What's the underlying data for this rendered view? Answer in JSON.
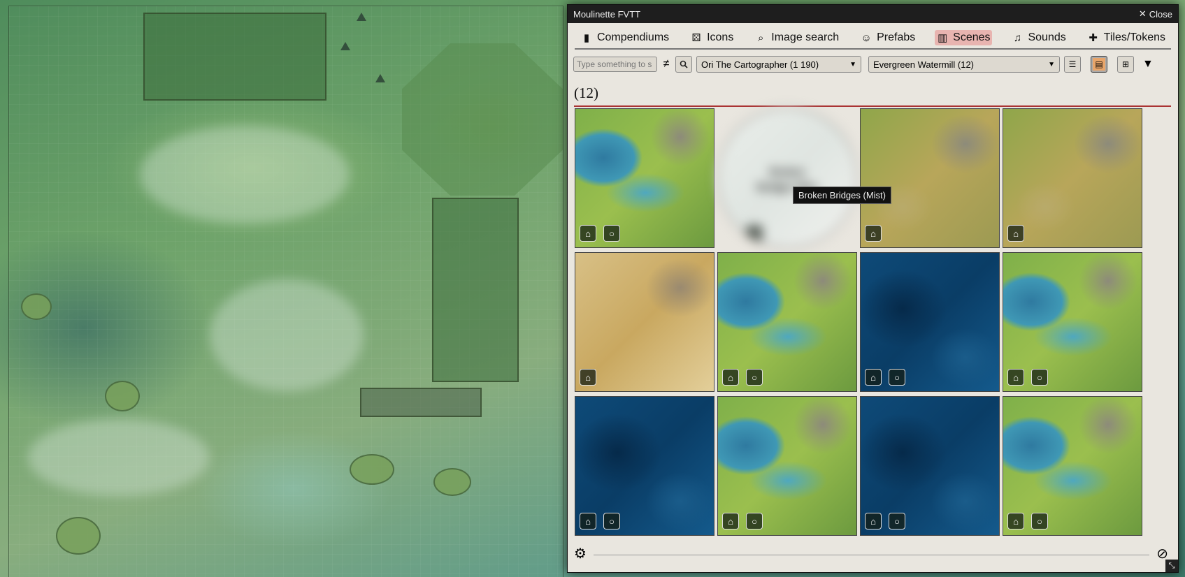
{
  "window": {
    "title": "Moulinette FVTT",
    "close_label": "Close"
  },
  "tabs": [
    {
      "label": "Compendiums",
      "icon": "book-icon"
    },
    {
      "label": "Icons",
      "icon": "dice-icon"
    },
    {
      "label": "Image search",
      "icon": "search-icon"
    },
    {
      "label": "Prefabs",
      "icon": "users-icon"
    },
    {
      "label": "Scenes",
      "icon": "map-icon",
      "active": true
    },
    {
      "label": "Sounds",
      "icon": "music-icon"
    },
    {
      "label": "Tiles/Tokens",
      "icon": "puzzle-icon"
    }
  ],
  "toolbar": {
    "search_placeholder": "Type something to s",
    "creator_select": "Ori The Cartographer (1 190)",
    "pack_select": "Evergreen Watermill (12)"
  },
  "result_count": "(12)",
  "thumbnails": [
    {
      "style": "green",
      "buttons": [
        "bank-icon",
        "lightbulb-icon"
      ]
    },
    {
      "style": "mist",
      "label": "Broken Bridges Mist",
      "buttons": [
        "bank-icon",
        "lightbulb-icon"
      ]
    },
    {
      "style": "sand",
      "buttons": [
        "bank-icon"
      ]
    },
    {
      "style": "sand",
      "buttons": [
        "bank-icon"
      ]
    },
    {
      "style": "desert",
      "buttons": [
        "bank-icon"
      ]
    },
    {
      "style": "green",
      "buttons": [
        "bank-icon",
        "lightbulb-icon"
      ]
    },
    {
      "style": "blue",
      "buttons": [
        "bank-icon",
        "lightbulb-icon"
      ]
    },
    {
      "style": "green",
      "buttons": [
        "bank-icon",
        "lightbulb-icon"
      ]
    },
    {
      "style": "blue",
      "buttons": [
        "bank-icon",
        "lightbulb-icon"
      ]
    },
    {
      "style": "green",
      "buttons": [
        "bank-icon",
        "lightbulb-icon"
      ]
    },
    {
      "style": "blue",
      "buttons": [
        "bank-icon",
        "lightbulb-icon"
      ]
    },
    {
      "style": "green",
      "buttons": [
        "bank-icon",
        "lightbulb-icon"
      ]
    }
  ],
  "tooltip": "Broken Bridges (Mist)"
}
